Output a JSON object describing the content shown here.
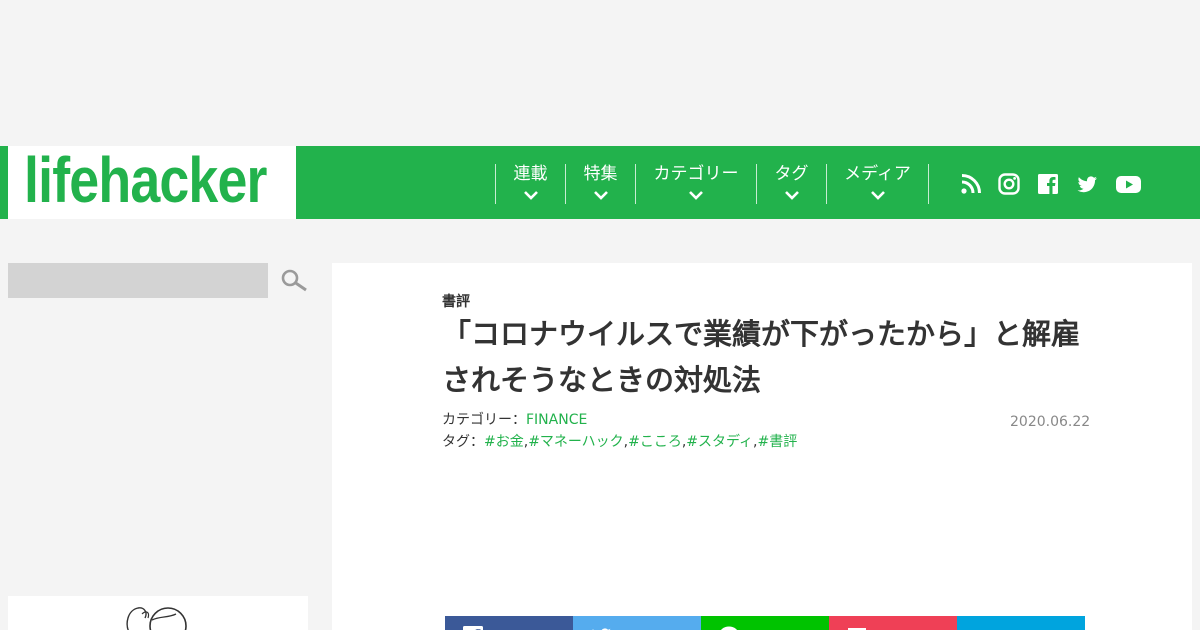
{
  "brand": {
    "logo_text": "lifehacker",
    "accent": "#22b24c"
  },
  "nav": {
    "items": [
      {
        "label": "連載"
      },
      {
        "label": "特集"
      },
      {
        "label": "カテゴリー"
      },
      {
        "label": "タグ"
      },
      {
        "label": "メディア"
      }
    ],
    "social_icons": [
      "rss-icon",
      "instagram-icon",
      "facebook-icon",
      "twitter-icon",
      "youtube-icon"
    ]
  },
  "sidebar": {
    "search_placeholder": ""
  },
  "article": {
    "category_label": "書評",
    "title": "「コロナウイルスで業績が下がったから」と解雇されそうなときの対処法",
    "category_prefix": "カテゴリー：",
    "category_value": "FINANCE",
    "tags_prefix": "タグ：",
    "tags": [
      "#お金",
      "#マネーハック",
      "#こころ",
      "#スタディ",
      "#書評"
    ],
    "tag_separator": ",",
    "date": "2020.06.22"
  },
  "share": {
    "buttons": [
      {
        "name": "facebook",
        "color": "#3b5998"
      },
      {
        "name": "twitter",
        "color": "#55acee"
      },
      {
        "name": "line",
        "color": "#00c300"
      },
      {
        "name": "pocket",
        "color": "#ef4056"
      },
      {
        "name": "hatena",
        "color": "#00a4de"
      }
    ]
  }
}
